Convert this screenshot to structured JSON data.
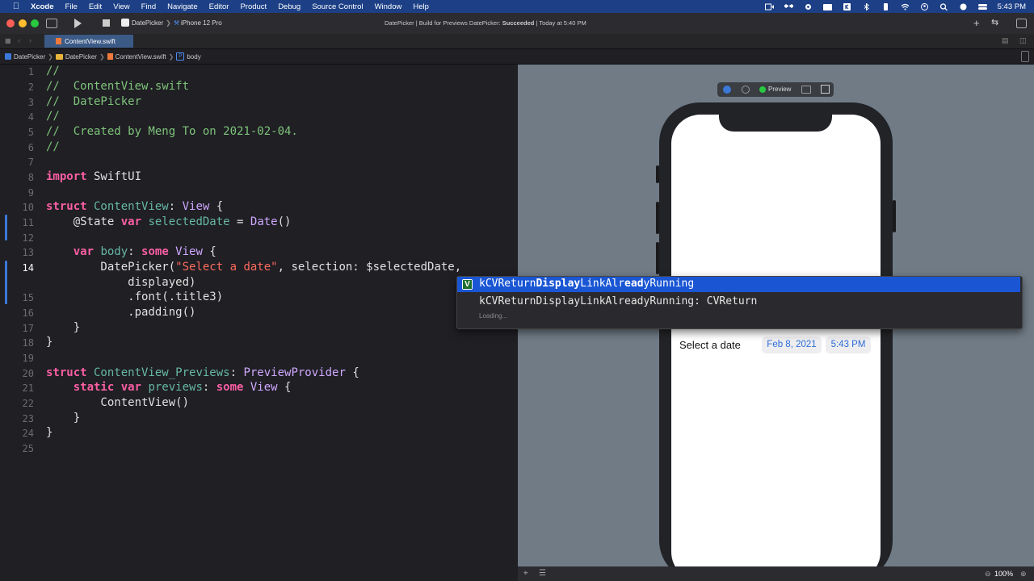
{
  "menubar": {
    "app": "Xcode",
    "items": [
      "File",
      "Edit",
      "View",
      "Find",
      "Navigate",
      "Editor",
      "Product",
      "Debug",
      "Source Control",
      "Window",
      "Help"
    ],
    "clock": "5:43 PM"
  },
  "toolbar": {
    "scheme": "DatePicker",
    "device": "iPhone 12 Pro",
    "activity_prefix": "DatePicker | Build for Previews DatePicker: ",
    "activity_status": "Succeeded",
    "activity_suffix": " | Today at 5:40 PM"
  },
  "tab": {
    "label": "ContentView.swift"
  },
  "jumpbar": [
    "DatePicker",
    "DatePicker",
    "ContentView.swift",
    "body"
  ],
  "editor": {
    "lines": [
      {
        "n": "1",
        "html": "cm:// "
      },
      {
        "n": "2",
        "html": "cm://  ContentView.swift"
      },
      {
        "n": "3",
        "html": "cm://  DatePicker"
      },
      {
        "n": "4",
        "html": "cm://"
      },
      {
        "n": "5",
        "html": "cm://  Created by Meng To on 2021-02-04."
      },
      {
        "n": "6",
        "html": "cm://"
      },
      {
        "n": "7",
        "html": ""
      },
      {
        "n": "8"
      },
      {
        "n": "9"
      },
      {
        "n": "10"
      },
      {
        "n": "11"
      },
      {
        "n": "12"
      },
      {
        "n": "13"
      },
      {
        "n": "14"
      },
      {
        "n": ""
      },
      {
        "n": "15"
      },
      {
        "n": "16"
      },
      {
        "n": "17"
      },
      {
        "n": "18"
      },
      {
        "n": "19"
      },
      {
        "n": "20"
      },
      {
        "n": "21"
      },
      {
        "n": "22"
      },
      {
        "n": "23"
      },
      {
        "n": "24"
      },
      {
        "n": "25"
      }
    ],
    "current_line": "14"
  },
  "code": {
    "l1": "//",
    "l2": "//  ContentView.swift",
    "l3": "//  DatePicker",
    "l4": "//",
    "l5": "//  Created by Meng To on 2021-02-04.",
    "l6": "//",
    "l8_kw": "import",
    "l8_rest": " SwiftUI",
    "l10_kw": "struct",
    "l10_name": " ContentView",
    "l10_colon": ": ",
    "l10_type": "View",
    "l10_end": " {",
    "l11_attr": "    @State ",
    "l11_kw": "var",
    "l11_name": " selectedDate",
    "l11_eq": " = ",
    "l11_type": "Date",
    "l11_end": "()",
    "l13_kw": "    var",
    "l13_name": " body",
    "l13_colon": ": ",
    "l13_kw2": "some",
    "l13_type": " View",
    "l13_end": " {",
    "l14_fn": "        DatePicker(",
    "l14_str": "\"Select a date\"",
    "l14_rest": ", selection: $selectedDate,",
    "l14b": "            displayed)",
    "l15": "            .font(.title3)",
    "l16": "            .padding()",
    "l17": "    }",
    "l18": "}",
    "l20_kw": "struct",
    "l20_name": " ContentView_Previews",
    "l20_colon": ": ",
    "l20_type": "PreviewProvider",
    "l20_end": " {",
    "l21_kw": "    static",
    "l21_kw2": " var",
    "l21_name": " previews",
    "l21_colon": ": ",
    "l21_kw3": "some",
    "l21_type": " View",
    "l21_end": " {",
    "l22": "        ContentView()",
    "l23": "    }",
    "l24": "}"
  },
  "autocomplete": {
    "badge": "V",
    "selected_pre": "kCVReturn",
    "selected_b1": "Display",
    "selected_mid": "LinkAlr",
    "selected_b2": "ead",
    "selected_post": "yRunning",
    "detail": "kCVReturnDisplayLinkAlreadyRunning",
    "detail_type": ": CVReturn",
    "loading": "Loading..."
  },
  "preview": {
    "label": "Preview",
    "picker_label": "Select a date",
    "date": "Feb 8, 2021",
    "time": "5:43 PM",
    "zoom": "100%"
  },
  "colors": {
    "accent": "#1a56d4",
    "menubar": "#1c3f86",
    "keyword": "#fc5fa3",
    "comment": "#7fc37a",
    "string": "#fc6a5d"
  }
}
